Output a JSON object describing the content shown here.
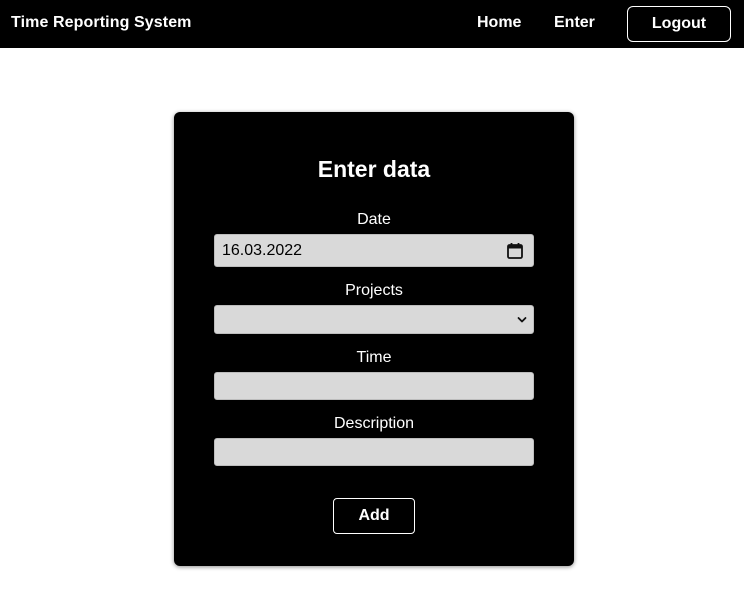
{
  "nav": {
    "brand": "Time Reporting System",
    "home": "Home",
    "enter": "Enter",
    "logout": "Logout"
  },
  "form": {
    "title": "Enter data",
    "date_label": "Date",
    "date_value": "16.03.2022",
    "projects_label": "Projects",
    "projects_value": "",
    "time_label": "Time",
    "time_value": "",
    "description_label": "Description",
    "description_value": "",
    "add_label": "Add"
  },
  "icons": {
    "date": "calendar-icon",
    "select": "chevron-down-icon"
  },
  "colors": {
    "navbar_bg": "#000000",
    "card_bg": "#000000",
    "input_bg": "#d9d9d9",
    "text_light": "#ffffff"
  }
}
